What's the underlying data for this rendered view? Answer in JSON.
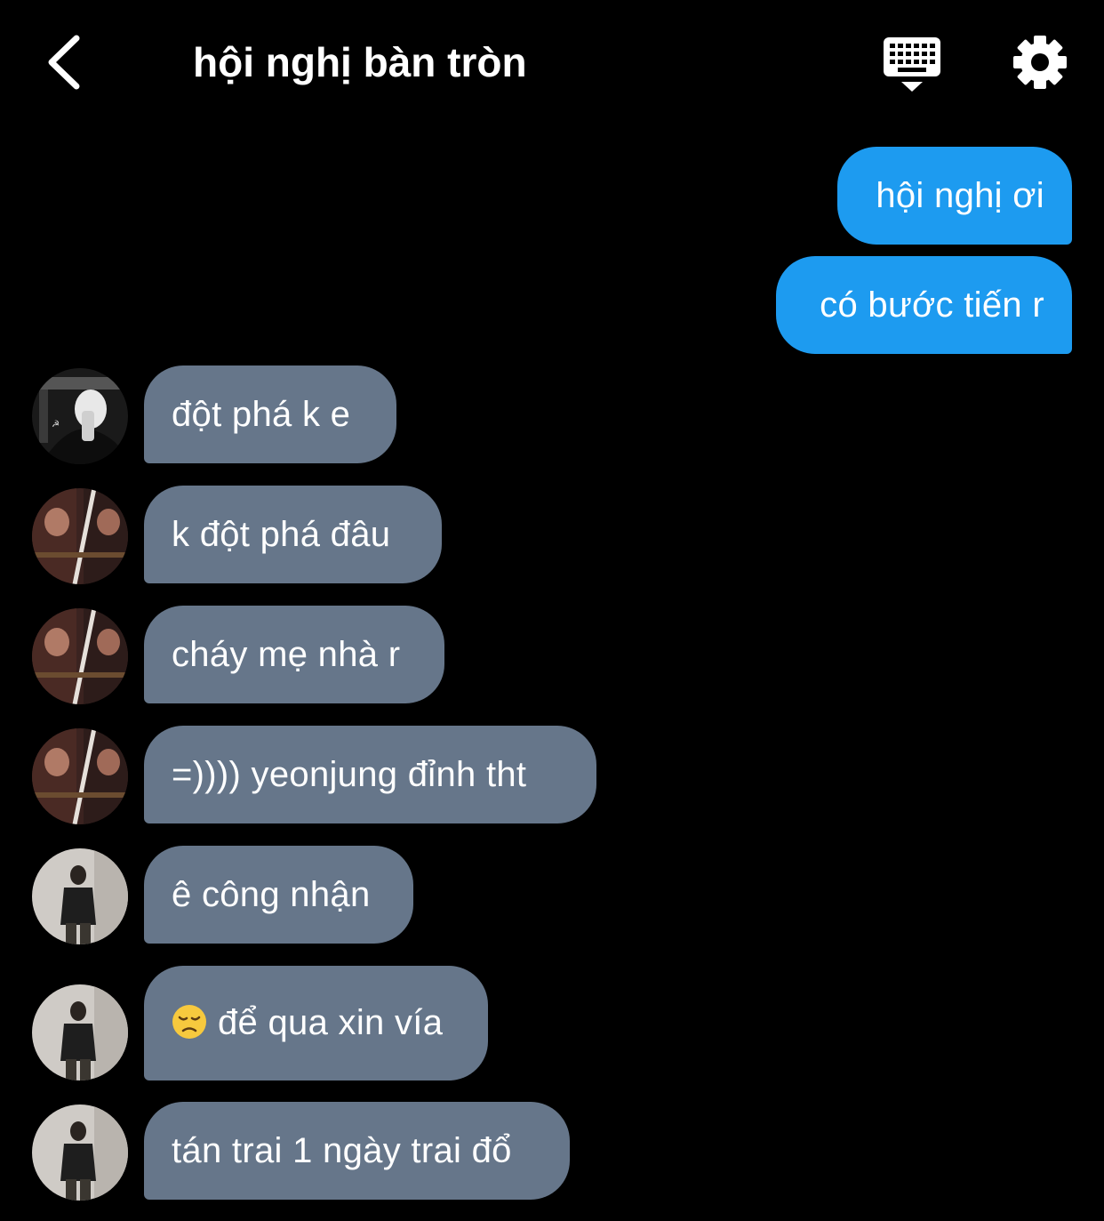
{
  "header": {
    "title": "hội nghị bàn tròn"
  },
  "icons": {
    "back": "chevron-left-icon",
    "keyboard": "keyboard-icon",
    "settings": "gear-icon",
    "emoji": "disappointed-face-emoji"
  },
  "colors": {
    "background": "#000000",
    "outgoing_bubble": "#1d9bf0",
    "incoming_bubble": "#66768a",
    "text": "#ffffff"
  },
  "messages": {
    "m0": "hội nghị ơi",
    "m1": "có bước tiến r",
    "m2": "đột phá k e",
    "m3": "k đột phá đâu",
    "m4": "cháy mẹ nhà r",
    "m5": "=)))) yeonjung đỉnh tht",
    "m6": "ê công nhận",
    "m7": "để qua xin vía",
    "m8": "tán trai 1 ngày trai đổ"
  }
}
